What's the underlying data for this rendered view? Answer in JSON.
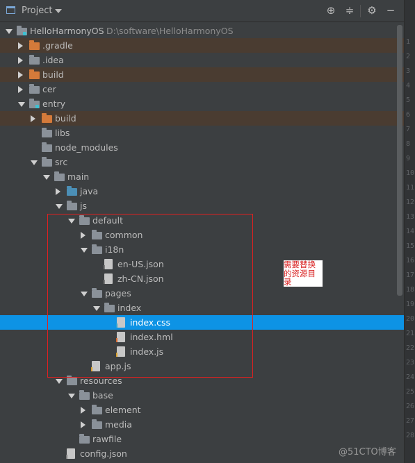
{
  "panel": {
    "title": "Project",
    "toolbar_icons": [
      "locate-icon",
      "collapse-all-icon",
      "settings-icon",
      "hide-icon"
    ]
  },
  "tree": [
    {
      "label": "HelloHarmonyOS",
      "path": "D:\\software\\HelloHarmonyOS",
      "depth": 0,
      "arrow": "down",
      "icon": "module",
      "state": ""
    },
    {
      "label": ".gradle",
      "depth": 1,
      "arrow": "right",
      "icon": "folder-orange",
      "state": "excluded"
    },
    {
      "label": ".idea",
      "depth": 1,
      "arrow": "right",
      "icon": "folder",
      "state": ""
    },
    {
      "label": "build",
      "depth": 1,
      "arrow": "right",
      "icon": "folder-orange",
      "state": "excluded"
    },
    {
      "label": "cer",
      "depth": 1,
      "arrow": "right",
      "icon": "folder",
      "state": ""
    },
    {
      "label": "entry",
      "depth": 1,
      "arrow": "down",
      "icon": "module",
      "state": ""
    },
    {
      "label": "build",
      "depth": 2,
      "arrow": "right",
      "icon": "folder-orange",
      "state": "excluded"
    },
    {
      "label": "libs",
      "depth": 2,
      "arrow": "",
      "icon": "folder",
      "state": ""
    },
    {
      "label": "node_modules",
      "depth": 2,
      "arrow": "",
      "icon": "folder",
      "state": ""
    },
    {
      "label": "src",
      "depth": 2,
      "arrow": "down",
      "icon": "folder",
      "state": ""
    },
    {
      "label": "main",
      "depth": 3,
      "arrow": "down",
      "icon": "folder",
      "state": ""
    },
    {
      "label": "java",
      "depth": 4,
      "arrow": "right",
      "icon": "folder-blue",
      "state": ""
    },
    {
      "label": "js",
      "depth": 4,
      "arrow": "down",
      "icon": "folder",
      "state": ""
    },
    {
      "label": "default",
      "depth": 5,
      "arrow": "down",
      "icon": "folder",
      "state": ""
    },
    {
      "label": "common",
      "depth": 6,
      "arrow": "right",
      "icon": "folder",
      "state": ""
    },
    {
      "label": "i18n",
      "depth": 6,
      "arrow": "down",
      "icon": "folder",
      "state": ""
    },
    {
      "label": "en-US.json",
      "depth": 7,
      "arrow": "",
      "icon": "file-json",
      "state": ""
    },
    {
      "label": "zh-CN.json",
      "depth": 7,
      "arrow": "",
      "icon": "file-json",
      "state": ""
    },
    {
      "label": "pages",
      "depth": 6,
      "arrow": "down",
      "icon": "folder",
      "state": ""
    },
    {
      "label": "index",
      "depth": 7,
      "arrow": "down",
      "icon": "folder",
      "state": ""
    },
    {
      "label": "index.css",
      "depth": 8,
      "arrow": "",
      "icon": "file-css",
      "state": "selected"
    },
    {
      "label": "index.hml",
      "depth": 8,
      "arrow": "",
      "icon": "file-hml",
      "state": ""
    },
    {
      "label": "index.js",
      "depth": 8,
      "arrow": "",
      "icon": "file-js",
      "state": ""
    },
    {
      "label": "app.js",
      "depth": 6,
      "arrow": "",
      "icon": "file-js",
      "state": ""
    },
    {
      "label": "resources",
      "depth": 4,
      "arrow": "down",
      "icon": "folder-res",
      "state": ""
    },
    {
      "label": "base",
      "depth": 5,
      "arrow": "down",
      "icon": "folder",
      "state": ""
    },
    {
      "label": "element",
      "depth": 6,
      "arrow": "right",
      "icon": "folder",
      "state": ""
    },
    {
      "label": "media",
      "depth": 6,
      "arrow": "right",
      "icon": "folder",
      "state": ""
    },
    {
      "label": "rawfile",
      "depth": 5,
      "arrow": "",
      "icon": "folder",
      "state": ""
    },
    {
      "label": "config.json",
      "depth": 4,
      "arrow": "",
      "icon": "file-json",
      "state": ""
    }
  ],
  "annotation": {
    "note": "需要替换的资源目录"
  },
  "gutter_lines": [
    "1",
    "2",
    "3",
    "4",
    "5",
    "6",
    "7",
    "8",
    "9",
    "10",
    "11",
    "12",
    "13",
    "14",
    "15",
    "16",
    "17",
    "18",
    "19",
    "20",
    "21",
    "22",
    "23",
    "24",
    "25",
    "26",
    "27",
    "28"
  ],
  "watermark": "@51CTO博客",
  "colors": {
    "background": "#3c3f41",
    "selection": "#0d93e5",
    "excluded": "#4a3c31",
    "annotation_border": "#e02020"
  }
}
